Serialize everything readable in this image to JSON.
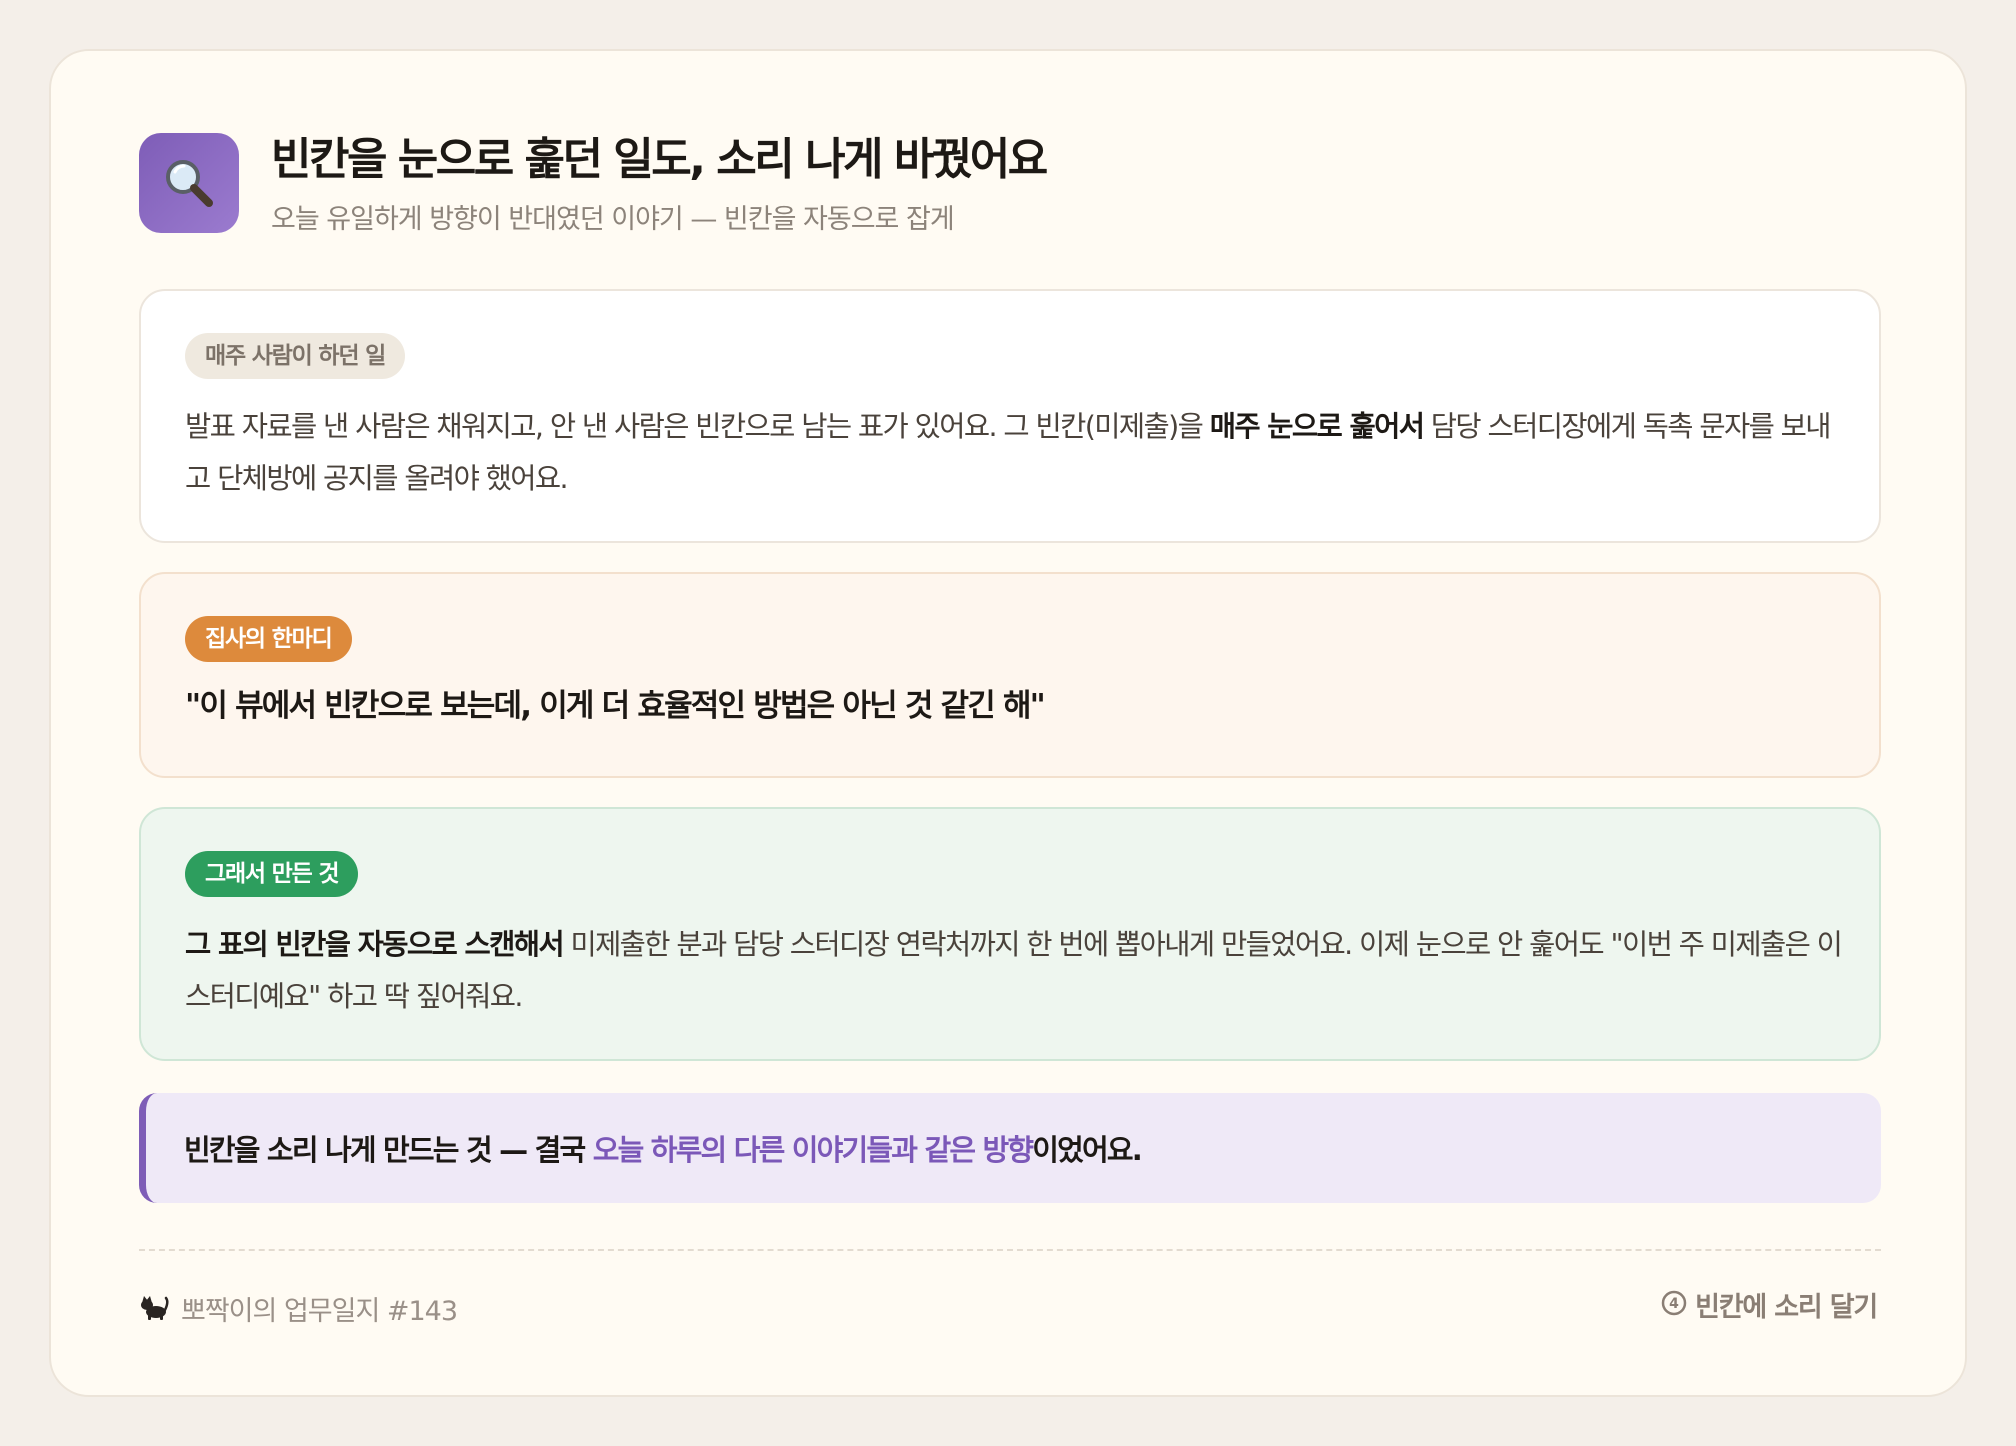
{
  "header": {
    "icon": "magnifying-glass-icon",
    "title": "빈칸을 눈으로 훑던 일도, 소리 나게 바꿨어요",
    "subtitle": "오늘 유일하게 방향이 반대였던 이야기 — 빈칸을 자동으로 잡게"
  },
  "before": {
    "tag": "매주 사람이 하던 일",
    "text_1": "발표 자료를 낸 사람은 채워지고, 안 낸 사람은 빈칸으로 남는 표가 있어요. 그 빈칸(미제출)을 ",
    "text_bold": "매주 눈으로 훑어서",
    "text_2": " 담당 스터디장에게 독촉 문자를 보내고 단체방에 공지를 올려야 했어요."
  },
  "quote": {
    "tag": "집사의 한마디",
    "text": "\"이 뷰에서 빈칸으로 보는데, 이게 더 효율적인 방법은 아닌 것 같긴 해\""
  },
  "result": {
    "tag": "그래서 만든 것",
    "text_bold": "그 표의 빈칸을 자동으로 스캔해서",
    "text_rest": " 미제출한 분과 담당 스터디장 연락처까지 한 번에 뽑아내게 만들었어요. 이제 눈으로 안 훑어도 \"이번 주 미제출은 이 스터디예요\" 하고 딱 짚어줘요."
  },
  "highlight": {
    "text_1": "빈칸을 소리 나게 만드는 것 — 결국 ",
    "accent": "오늘 하루의 다른 이야기들과 같은 방향",
    "text_2": "이었어요."
  },
  "footer": {
    "left_icon": "cat-icon",
    "left_text": "뽀짝이의 업무일지 #143",
    "right_icon": "circled-4-icon",
    "right_number": "4",
    "right_text": "빈칸에 소리 달기"
  },
  "colors": {
    "accent_purple": "#7e5db7",
    "orange_tag": "#dd8a3c",
    "green_tag": "#2d9e5e"
  }
}
